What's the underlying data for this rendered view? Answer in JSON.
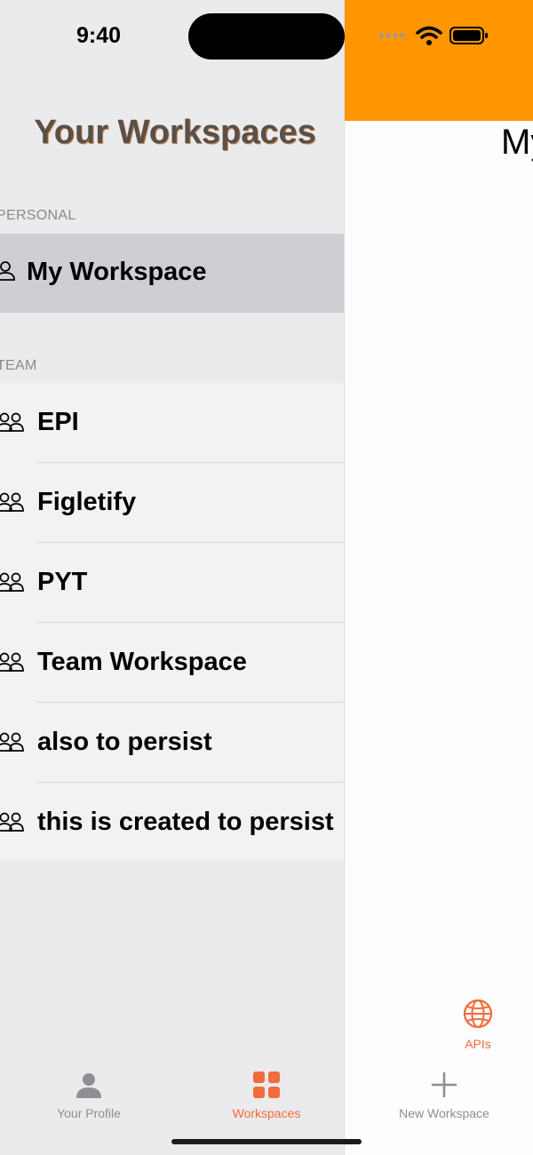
{
  "status": {
    "time": "9:40"
  },
  "drawer": {
    "title": "Your Workspaces",
    "personal_label": "PERSONAL",
    "personal_workspace": "My Workspace",
    "team_label": "TEAM",
    "team_workspaces": [
      "EPI",
      "Figletify",
      "PYT",
      "Team Workspace",
      "also to persist",
      "this is created to persist"
    ]
  },
  "right_pane": {
    "title": "My",
    "apis_label": "APIs"
  },
  "tabs": {
    "profile": "Your Profile",
    "workspaces": "Workspaces",
    "new_workspace": "New Workspace"
  },
  "colors": {
    "accent": "#f26b3a",
    "header": "#ff9500",
    "tab_inactive": "#8e8e93"
  },
  "icons": [
    "person-icon",
    "people-icon",
    "globe-icon",
    "person-filled-icon",
    "grid-icon",
    "plus-icon",
    "signal-icon",
    "wifi-icon",
    "battery-icon"
  ]
}
